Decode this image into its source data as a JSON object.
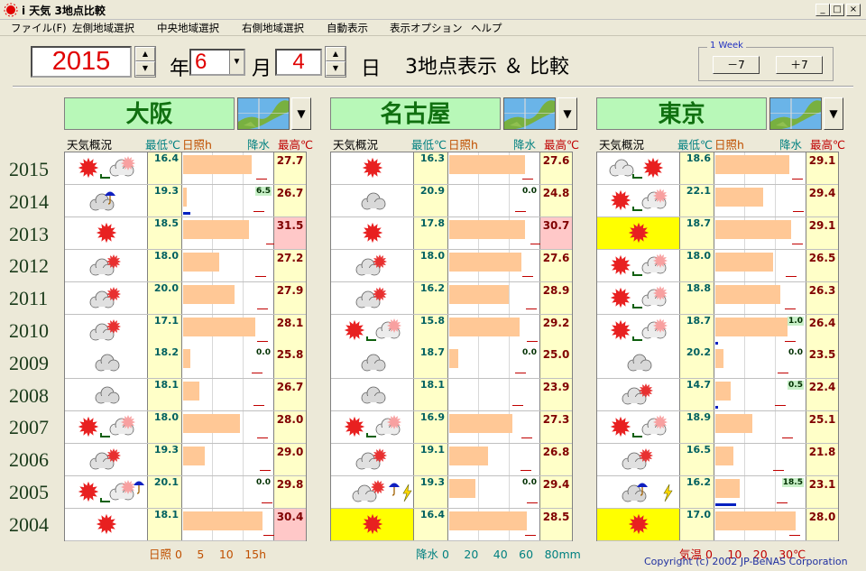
{
  "window": {
    "title": "i 天気 3地点比較"
  },
  "menu": [
    "ファイル(F)",
    "左側地域選択",
    "中央地域選択",
    "右側地域選択",
    "自動表示",
    "表示オプション",
    "ヘルプ"
  ],
  "date": {
    "year": "2015",
    "year_label": "年",
    "month": "6",
    "month_label": "月",
    "day": "4",
    "day_label": "日",
    "headline": "3地点表示 ＆ 比較"
  },
  "week": {
    "label": "1 Week",
    "minus": "－7",
    "plus": "＋7"
  },
  "years": [
    "2015",
    "2014",
    "2013",
    "2012",
    "2011",
    "2010",
    "2009",
    "2008",
    "2007",
    "2006",
    "2005",
    "2004"
  ],
  "headers": {
    "weather": "天気概況",
    "min": "最低℃",
    "sun": "日照h",
    "rain": "降水",
    "max": "最高℃"
  },
  "cities": [
    {
      "name": "大阪",
      "rows": [
        {
          "icons": [
            "sun",
            "cloud"
          ],
          "min": "16.4",
          "sun": 11.6,
          "rain": "",
          "max": "27.7",
          "hot": false,
          "hl": false
        },
        {
          "icons": [
            "cloud",
            "umbrella"
          ],
          "min": "19.3",
          "sun": 0.6,
          "rain": "6.5",
          "max": "26.7",
          "hot": false,
          "hl": false
        },
        {
          "icons": [
            "sun"
          ],
          "min": "18.5",
          "sun": 11.2,
          "rain": "",
          "max": "31.5",
          "hot": true,
          "hl": false
        },
        {
          "icons": [
            "cloud",
            "sunsmall"
          ],
          "min": "18.0",
          "sun": 6.1,
          "rain": "",
          "max": "27.2",
          "hot": false,
          "hl": false
        },
        {
          "icons": [
            "cloud",
            "sunsmall"
          ],
          "min": "20.0",
          "sun": 8.8,
          "rain": "",
          "max": "27.9",
          "hot": false,
          "hl": false
        },
        {
          "icons": [
            "cloud",
            "sunsmall"
          ],
          "min": "17.1",
          "sun": 12.2,
          "rain": "",
          "max": "28.1",
          "hot": false,
          "hl": false
        },
        {
          "icons": [
            "cloud"
          ],
          "min": "18.2",
          "sun": 1.2,
          "rain": "0.0",
          "max": "25.8",
          "hot": false,
          "hl": false
        },
        {
          "icons": [
            "cloud"
          ],
          "min": "18.1",
          "sun": 2.7,
          "rain": "",
          "max": "26.7",
          "hot": false,
          "hl": false
        },
        {
          "icons": [
            "sun",
            "cloud"
          ],
          "min": "18.0",
          "sun": 9.6,
          "rain": "",
          "max": "28.0",
          "hot": false,
          "hl": false
        },
        {
          "icons": [
            "cloud",
            "sunsmall"
          ],
          "min": "19.3",
          "sun": 3.6,
          "rain": "",
          "max": "29.0",
          "hot": false,
          "hl": false
        },
        {
          "icons": [
            "sun",
            "cloud",
            "umbrella"
          ],
          "min": "20.1",
          "sun": 0,
          "rain": "0.0",
          "max": "29.8",
          "hot": false,
          "hl": false
        },
        {
          "icons": [
            "sun"
          ],
          "min": "18.1",
          "sun": 13.4,
          "rain": "",
          "max": "30.4",
          "hot": true,
          "hl": false
        }
      ]
    },
    {
      "name": "名古屋",
      "rows": [
        {
          "icons": [
            "sun"
          ],
          "min": "16.3",
          "sun": 12.8,
          "rain": "",
          "max": "27.6",
          "hot": false,
          "hl": false
        },
        {
          "icons": [
            "cloud"
          ],
          "min": "20.9",
          "sun": 0,
          "rain": "0.0",
          "max": "24.8",
          "hot": false,
          "hl": false
        },
        {
          "icons": [
            "sun"
          ],
          "min": "17.8",
          "sun": 12.8,
          "rain": "",
          "max": "30.7",
          "hot": true,
          "hl": false
        },
        {
          "icons": [
            "cloud",
            "sunsmall"
          ],
          "min": "18.0",
          "sun": 12.2,
          "rain": "",
          "max": "27.6",
          "hot": false,
          "hl": false
        },
        {
          "icons": [
            "cloud",
            "sunsmall"
          ],
          "min": "16.2",
          "sun": 10.1,
          "rain": "",
          "max": "28.9",
          "hot": false,
          "hl": false
        },
        {
          "icons": [
            "sun",
            "cloud"
          ],
          "min": "15.8",
          "sun": 11.9,
          "rain": "",
          "max": "29.2",
          "hot": false,
          "hl": false
        },
        {
          "icons": [
            "cloud"
          ],
          "min": "18.7",
          "sun": 1.6,
          "rain": "0.0",
          "max": "25.0",
          "hot": false,
          "hl": false
        },
        {
          "icons": [
            "cloud"
          ],
          "min": "18.1",
          "sun": 0,
          "rain": "",
          "max": "23.9",
          "hot": false,
          "hl": false
        },
        {
          "icons": [
            "sun",
            "cloud"
          ],
          "min": "16.9",
          "sun": 10.7,
          "rain": "",
          "max": "27.3",
          "hot": false,
          "hl": false
        },
        {
          "icons": [
            "cloud",
            "sunsmall"
          ],
          "min": "19.1",
          "sun": 6.6,
          "rain": "",
          "max": "26.8",
          "hot": false,
          "hl": false
        },
        {
          "icons": [
            "cloud",
            "sun",
            "umbrella",
            "bolt"
          ],
          "min": "19.3",
          "sun": 4.4,
          "rain": "0.0",
          "max": "29.4",
          "hot": false,
          "hl": false
        },
        {
          "icons": [
            "sun"
          ],
          "min": "16.4",
          "sun": 13.1,
          "rain": "",
          "max": "28.5",
          "hot": false,
          "hl": true
        }
      ]
    },
    {
      "name": "東京",
      "rows": [
        {
          "icons": [
            "cloud",
            "sun"
          ],
          "min": "18.6",
          "sun": 12.6,
          "rain": "",
          "max": "29.1",
          "hot": false,
          "hl": false
        },
        {
          "icons": [
            "sun",
            "cloud"
          ],
          "min": "22.1",
          "sun": 8.1,
          "rain": "",
          "max": "29.4",
          "hot": false,
          "hl": false
        },
        {
          "icons": [
            "sun"
          ],
          "min": "18.7",
          "sun": 12.8,
          "rain": "",
          "max": "29.1",
          "hot": false,
          "hl": true
        },
        {
          "icons": [
            "sun",
            "cloud"
          ],
          "min": "18.0",
          "sun": 9.8,
          "rain": "",
          "max": "26.5",
          "hot": false,
          "hl": false
        },
        {
          "icons": [
            "sun",
            "cloud"
          ],
          "min": "18.8",
          "sun": 11.0,
          "rain": "",
          "max": "26.3",
          "hot": false,
          "hl": false
        },
        {
          "icons": [
            "sun",
            "cloud"
          ],
          "min": "18.7",
          "sun": 12.3,
          "rain": "1.0",
          "max": "26.4",
          "hot": false,
          "hl": false
        },
        {
          "icons": [
            "cloud"
          ],
          "min": "20.2",
          "sun": 1.4,
          "rain": "0.0",
          "max": "23.5",
          "hot": false,
          "hl": false
        },
        {
          "icons": [
            "cloud",
            "sunsmall"
          ],
          "min": "14.7",
          "sun": 2.6,
          "rain": "0.5",
          "max": "22.4",
          "hot": false,
          "hl": false
        },
        {
          "icons": [
            "sun",
            "cloud"
          ],
          "min": "18.9",
          "sun": 6.2,
          "rain": "",
          "max": "25.1",
          "hot": false,
          "hl": false
        },
        {
          "icons": [
            "cloud",
            "sunsmall"
          ],
          "min": "16.5",
          "sun": 3.1,
          "rain": "",
          "max": "21.8",
          "hot": false,
          "hl": false
        },
        {
          "icons": [
            "cloud",
            "umbrella",
            "bolt"
          ],
          "min": "16.2",
          "sun": 4.1,
          "rain": "18.5",
          "max": "23.1",
          "hot": false,
          "hl": false
        },
        {
          "icons": [
            "sun"
          ],
          "min": "17.0",
          "sun": 13.6,
          "rain": "",
          "max": "28.0",
          "hot": false,
          "hl": true
        }
      ]
    }
  ],
  "axes": {
    "sun": "日照 0　 5　 10　15h",
    "rain": "降水 0　 20　 40　60　80mm",
    "temp": "気温 0　 10　20　30℃"
  },
  "copyright": "Copyright (c) 2002 JP-BeNAS Corporation"
}
